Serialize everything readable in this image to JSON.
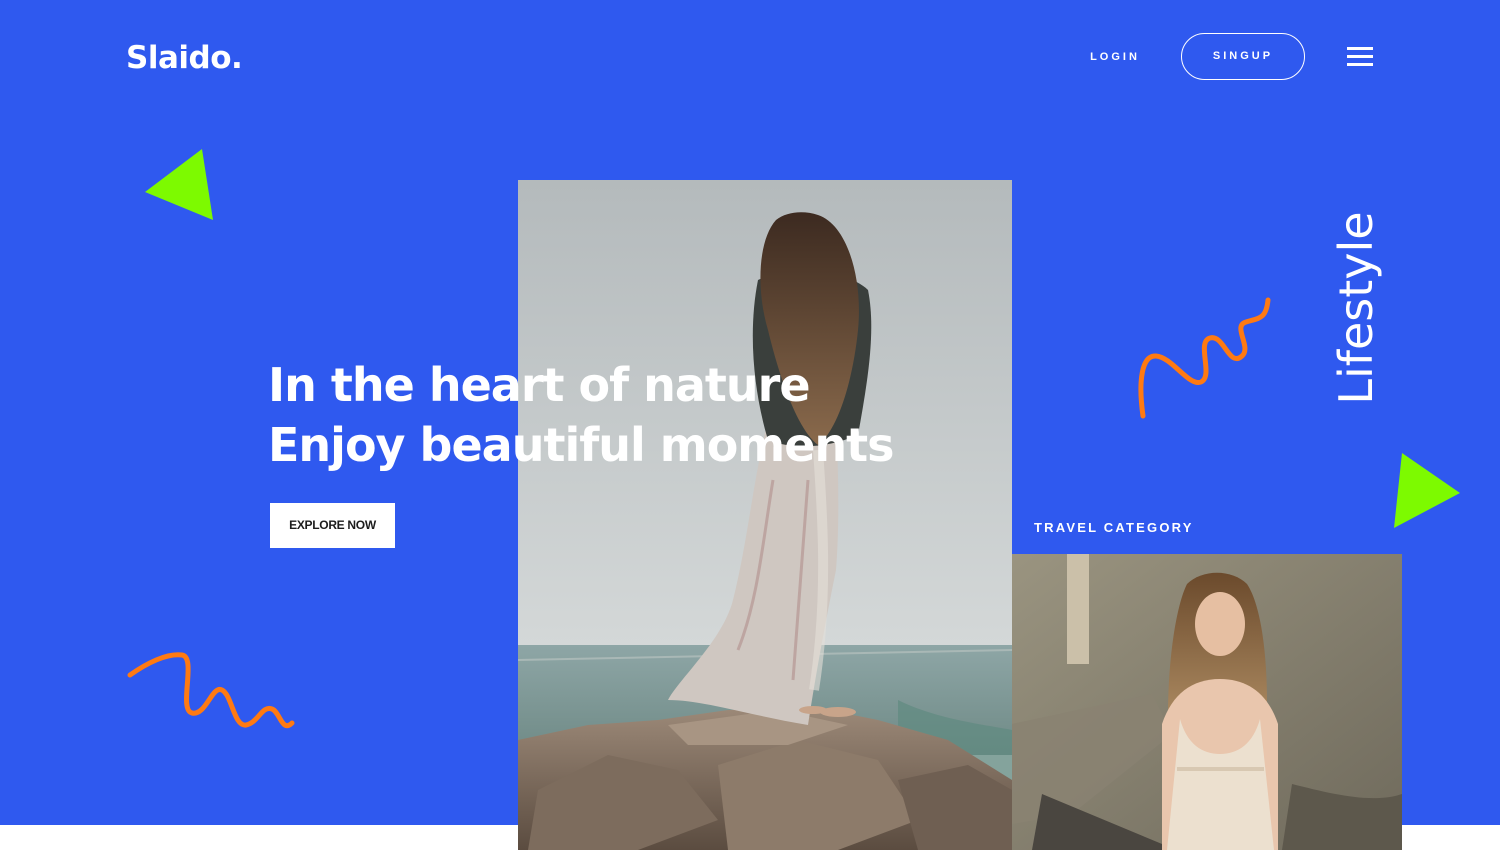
{
  "brand": {
    "logo": "Slaido."
  },
  "nav": {
    "login_label": "LOGIN",
    "signup_label": "SINGUP",
    "menu_icon": "hamburger-menu-icon"
  },
  "hero": {
    "headline_line1": "In the heart of nature",
    "headline_line2": "Enjoy beautiful moments",
    "cta_label": "EXPLORE NOW",
    "vertical_label": "Lifestyle",
    "category_label": "TRAVEL CATEGORY"
  },
  "colors": {
    "background": "#2f59ef",
    "accent_green": "#7dfa00",
    "accent_orange": "#ff7a12",
    "text": "#ffffff"
  }
}
